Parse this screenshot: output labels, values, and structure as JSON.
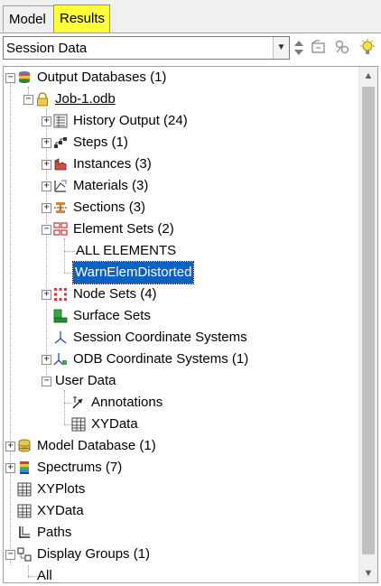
{
  "tabs": [
    {
      "label": "Model",
      "active": false
    },
    {
      "label": "Results",
      "active": true,
      "highlight": "#ffff3a"
    }
  ],
  "toolbar": {
    "combo_value": "Session Data",
    "icons": [
      "up-down-arrows-icon",
      "folder-options-icon",
      "filter-icon",
      "lightbulb-icon"
    ]
  },
  "tree": {
    "output_databases": "Output Databases (1)",
    "job": "Job-1.odb",
    "history_output": "History Output (24)",
    "steps": "Steps (1)",
    "instances": "Instances (3)",
    "materials": "Materials (3)",
    "sections": "Sections (3)",
    "element_sets": "Element Sets (2)",
    "all_elements": "ALL ELEMENTS",
    "warn_elem": "WarnElemDistorted",
    "node_sets": "Node Sets (4)",
    "surface_sets": "Surface Sets",
    "session_coord": "Session Coordinate Systems",
    "odb_coord": "ODB Coordinate Systems (1)",
    "user_data": "User Data",
    "annotations": "Annotations",
    "xydata_sub": "XYData",
    "model_database": "Model Database (1)",
    "spectrums": "Spectrums (7)",
    "xyplots": "XYPlots",
    "xydata": "XYData",
    "paths": "Paths",
    "display_groups": "Display Groups (1)",
    "all": "All"
  },
  "colors": {
    "selection": "#0a62c4",
    "results_tab": "#ffff3a"
  }
}
